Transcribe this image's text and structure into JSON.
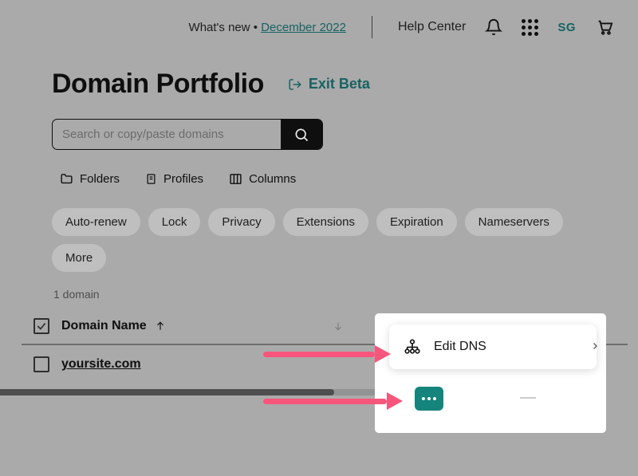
{
  "header": {
    "whats_new_prefix": "What's new • ",
    "whats_new_link": "December 2022",
    "help_center": "Help Center",
    "account_initials": "SG"
  },
  "page": {
    "title": "Domain Portfolio",
    "exit_beta": "Exit Beta"
  },
  "search": {
    "placeholder": "Search or copy/paste domains"
  },
  "toolbar": {
    "folders": "Folders",
    "profiles": "Profiles",
    "columns": "Columns"
  },
  "filters": [
    "Auto-renew",
    "Lock",
    "Privacy",
    "Extensions",
    "Expiration",
    "Nameservers",
    "More"
  ],
  "list": {
    "count_label": "1 domain",
    "header_name": "Domain Name",
    "rows": [
      {
        "domain": "yoursite.com"
      }
    ]
  },
  "popup": {
    "edit_dns": "Edit DNS"
  }
}
